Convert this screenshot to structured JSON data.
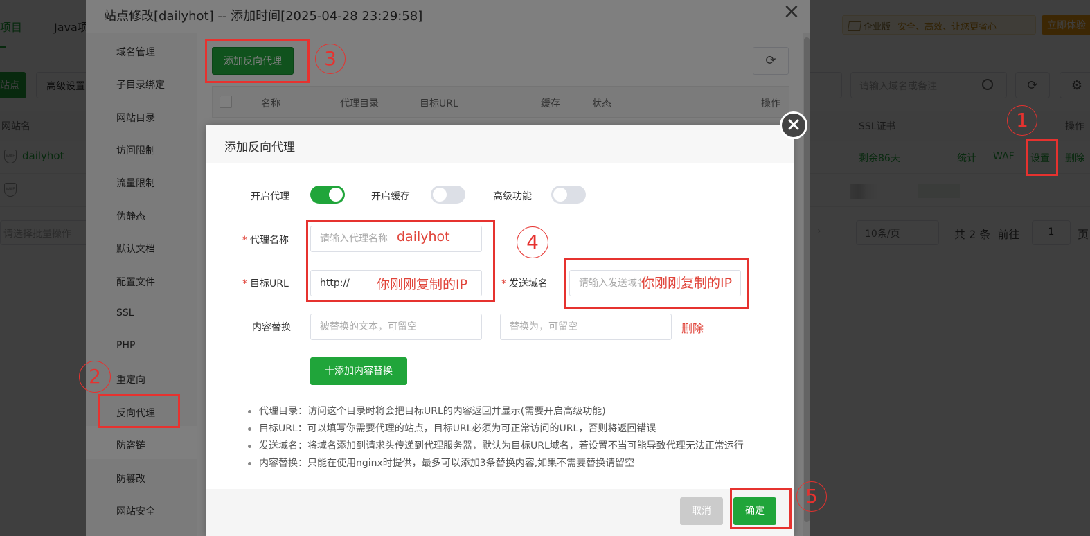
{
  "background": {
    "tabs": [
      "项目",
      "Java项"
    ],
    "promo_edition": "企业版",
    "promo_text": "安全、高效、让您更省心",
    "trial_button": "立即体验",
    "add_site_button": "站点",
    "advanced_button": "高级设置",
    "search_placeholder": "请输入域名或备注",
    "columns": {
      "name": "网站名",
      "ssl": "SSL证书",
      "ops": "操作"
    },
    "rows": [
      {
        "name": "dailyhot",
        "ssl": "剩余86天",
        "ops": [
          "统计",
          "WAF",
          "设置",
          "删除"
        ]
      }
    ],
    "batch_placeholder": "请选择批量操作",
    "page_size": "10条/页",
    "total": "共 2 条",
    "goto": "前往",
    "page_number": "1",
    "page_suffix": "页"
  },
  "outer_modal": {
    "title": "站点修改[dailyhot] -- 添加时间[2025-04-28 23:29:58]",
    "sidebar": [
      "域名管理",
      "子目录绑定",
      "网站目录",
      "访问限制",
      "流量限制",
      "伪静态",
      "默认文档",
      "配置文件",
      "SSL",
      "PHP",
      "重定向",
      "反向代理",
      "防盗链",
      "防篡改",
      "网站安全"
    ],
    "active_item": "反向代理",
    "add_proxy_button": "添加反向代理",
    "table_headers": [
      "名称",
      "代理目录",
      "目标URL",
      "缓存",
      "状态",
      "操作"
    ]
  },
  "dialog": {
    "title": "添加反向代理",
    "toggles": [
      {
        "label": "开启代理",
        "on": true
      },
      {
        "label": "开启缓存",
        "on": false
      },
      {
        "label": "高级功能",
        "on": false
      }
    ],
    "proxy_name_label": "代理名称",
    "proxy_name_placeholder": "请输入代理名称",
    "target_url_label": "目标URL",
    "target_url_value": "http://",
    "send_domain_label": "发送域名",
    "send_domain_placeholder": "请输入发送域名",
    "replace_label": "内容替换",
    "replace_from_placeholder": "被替换的文本，可留空",
    "replace_to_placeholder": "替换为，可留空",
    "delete_link": "删除",
    "add_replace_button": "十添加内容替换",
    "notes": [
      "代理目录：访问这个目录时将会把目标URL的内容返回并显示(需要开启高级功能)",
      "目标URL：可以填写你需要代理的站点，目标URL必须为可正常访问的URL，否则将返回错误",
      "发送域名：将域名添加到请求头传递到代理服务器，默认为目标URL域名，若设置不当可能导致代理无法正常运行",
      "内容替换：只能在使用nginx时提供，最多可以添加3条替换内容,如果不需要替换请留空"
    ],
    "cancel_button": "取消",
    "confirm_button": "确定"
  },
  "annotations": {
    "proxy_name_note": "dailyhot",
    "ip_note": "你刚刚复制的IP",
    "step_numbers": [
      "1",
      "2",
      "3",
      "4",
      "5"
    ],
    "color": "#e6322f"
  }
}
